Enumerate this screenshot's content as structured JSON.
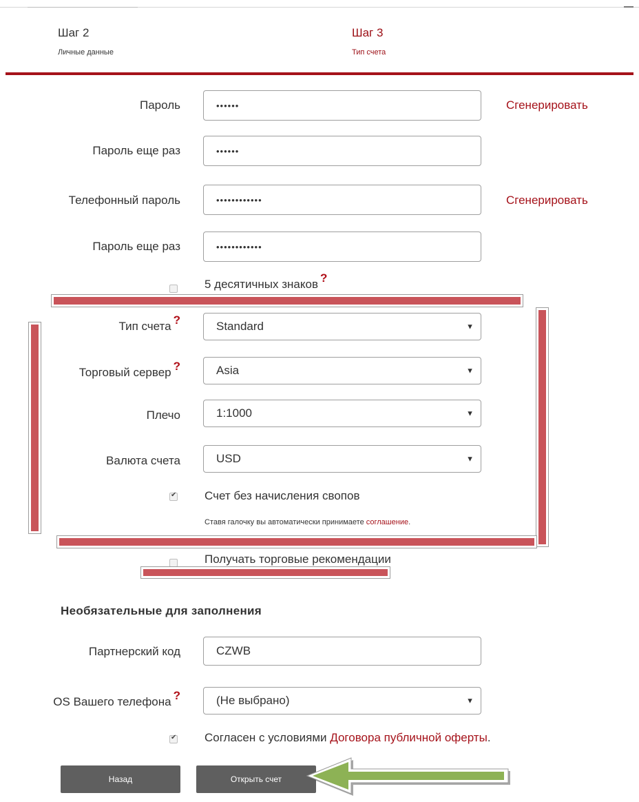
{
  "steps": [
    {
      "num": "Шаг 2",
      "sub": "Личные данные"
    },
    {
      "num": "Шаг 3",
      "sub": "Тип счета"
    }
  ],
  "form": {
    "password_label": "Пароль",
    "password_value": "••••••",
    "password_repeat_label": "Пароль еще раз",
    "password_repeat_value": "••••••",
    "phone_password_label": "Телефонный пароль",
    "phone_password_value": "••••••••••••",
    "phone_password_repeat_label": "Пароль еще раз",
    "phone_password_repeat_value": "••••••••••••",
    "generate_label": "Сгенерировать",
    "five_decimals_label": "5 десятичных знаков",
    "help_mark": "?",
    "account_type_label": "Тип счета",
    "account_type_value": "Standard",
    "server_label": "Торговый сервер",
    "server_value": "Asia",
    "leverage_label": "Плечо",
    "leverage_value": "1:1000",
    "currency_label": "Валюта счета",
    "currency_value": "USD",
    "swap_free_label": "Счет без начисления свопов",
    "swap_note_text": "Ставя галочку вы автоматически принимаете ",
    "swap_note_link": "соглашение",
    "swap_note_end": ".",
    "recommendations_label": "Получать торговые рекомендации"
  },
  "optional": {
    "title": "Необязательные для заполнения",
    "partner_label": "Партнерский код",
    "partner_value": "CZWB",
    "os_label": "OS Вашего телефона",
    "os_value": "(Не выбрано)",
    "agree_text": "Согласен с условиями ",
    "agree_link": "Договора публичной оферты",
    "agree_end": "."
  },
  "buttons": {
    "back": "Назад",
    "open": "Открыть счет"
  },
  "icons": {
    "caret": "▼",
    "check": "✔"
  },
  "colors": {
    "accent": "#a5121a",
    "button": "#5f5f5f",
    "annotation": "#c9545a",
    "arrow": "#8db255"
  }
}
